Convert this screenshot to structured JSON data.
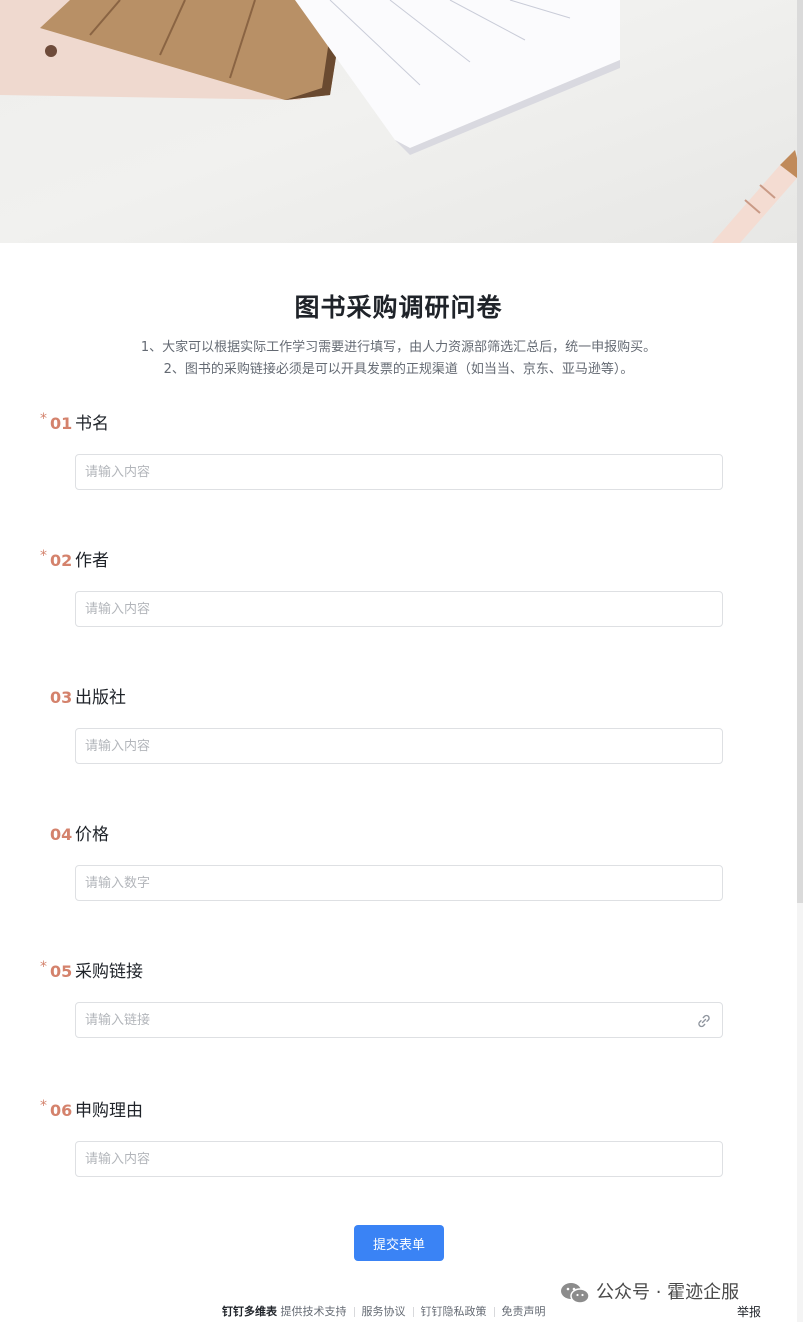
{
  "form": {
    "title": "图书采购调研问卷",
    "description": [
      "1、大家可以根据实际工作学习需要进行填写，由人力资源部筛选汇总后，统一申报购买。",
      "2、图书的采购链接必须是可以开具发票的正规渠道（如当当、京东、亚马逊等）。"
    ]
  },
  "questions": [
    {
      "required": "*",
      "number": "01",
      "label": "书名",
      "placeholder": "请输入内容"
    },
    {
      "required": "*",
      "number": "02",
      "label": "作者",
      "placeholder": "请输入内容"
    },
    {
      "required": "",
      "number": "03",
      "label": "出版社",
      "placeholder": "请输入内容"
    },
    {
      "required": "",
      "number": "04",
      "label": "价格",
      "placeholder": "请输入数字"
    },
    {
      "required": "*",
      "number": "05",
      "label": "采购链接",
      "placeholder": "请输入链接",
      "icon": "link-icon"
    },
    {
      "required": "*",
      "number": "06",
      "label": "申购理由",
      "placeholder": "请输入内容"
    }
  ],
  "submit_label": "提交表单",
  "footer": {
    "brand": "钉钉多维表",
    "support": "提供技术支持",
    "links": [
      "服务协议",
      "钉钉隐私政策",
      "免责声明"
    ]
  },
  "watermark": "公众号 · 霍迹企服",
  "report_label": "举报",
  "colors": {
    "accent": "#3a83f5",
    "required": "#d4826c",
    "text": "#1f2329",
    "muted": "#646a73"
  }
}
